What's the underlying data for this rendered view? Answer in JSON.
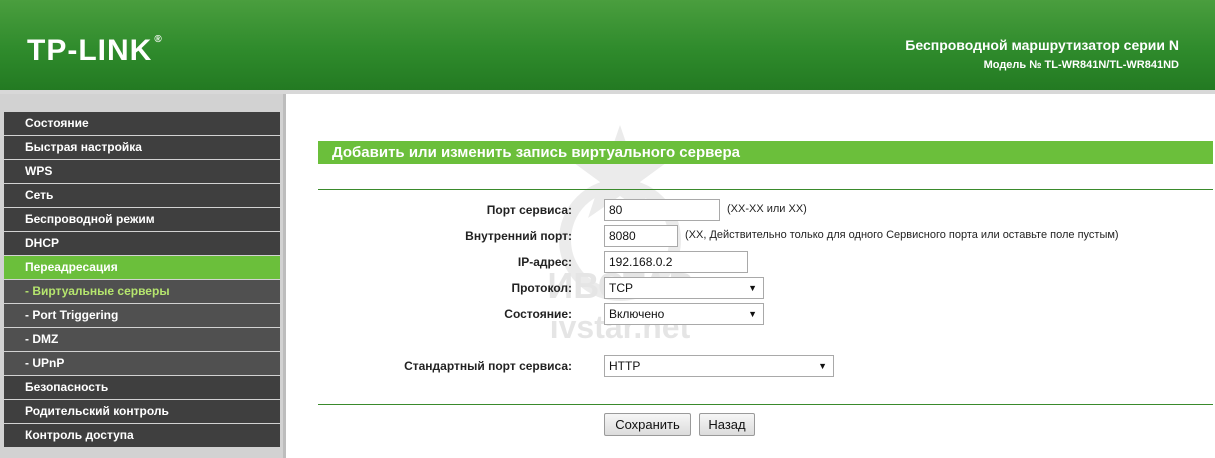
{
  "header": {
    "logo": "TP-LINK",
    "logo_mark": "®",
    "title": "Беспроводной маршрутизатор серии N",
    "model": "Модель № TL-WR841N/TL-WR841ND"
  },
  "sidebar": {
    "items": [
      {
        "label": "Состояние"
      },
      {
        "label": "Быстрая настройка"
      },
      {
        "label": "WPS"
      },
      {
        "label": "Сеть"
      },
      {
        "label": "Беспроводной режим"
      },
      {
        "label": "DHCP"
      },
      {
        "label": "Переадресация"
      },
      {
        "label": "- Виртуальные серверы"
      },
      {
        "label": "- Port Triggering"
      },
      {
        "label": "- DMZ"
      },
      {
        "label": "- UPnP"
      },
      {
        "label": "Безопасность"
      },
      {
        "label": "Родительский контроль"
      },
      {
        "label": "Контроль доступа"
      }
    ]
  },
  "main": {
    "section_title": "Добавить или изменить запись виртуального сервера",
    "form": {
      "service_port_label": "Порт сервиса:",
      "service_port_value": "80",
      "service_port_hint": "(XX-XX или XX)",
      "internal_port_label": "Внутренний порт:",
      "internal_port_value": "8080",
      "internal_port_hint": "(XX, Действительно только для одного Сервисного порта или оставьте поле пустым)",
      "ip_label": "IP-адрес:",
      "ip_value": "192.168.0.2",
      "protocol_label": "Протокол:",
      "protocol_value": "TCP",
      "status_label": "Состояние:",
      "status_value": "Включено",
      "std_port_label": "Стандартный порт сервиса:",
      "std_port_value": "HTTP"
    },
    "buttons": {
      "save": "Сохранить",
      "back": "Назад"
    }
  },
  "watermark": {
    "line1": "ИВСТАР",
    "line2": "ivstar.net"
  },
  "colors": {
    "header_green": "#2f8b2c",
    "accent_green": "#6bbf3b",
    "sidebar_dark": "#3f3f3f",
    "current_subitem": "#b5e56e"
  }
}
